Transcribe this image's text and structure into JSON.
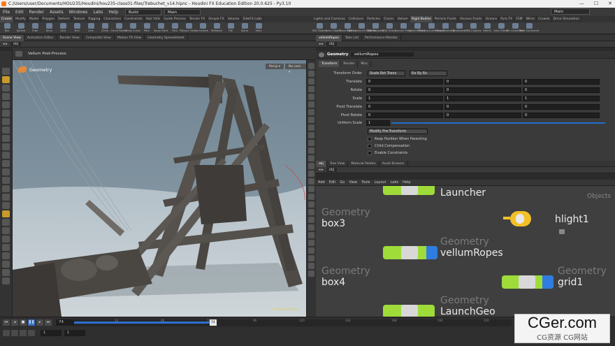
{
  "titlebar": {
    "text": "C:/Users/user/Documents/HOU235/Houdini/hou235-class01-files/Trebuchet_v14.hipnc - Houdini FX Education Edition 20.0.625 - Py3.10",
    "minimize": "—",
    "maximize": "☐",
    "close": "✕"
  },
  "menubar": {
    "items": [
      "File",
      "Edit",
      "Render",
      "Assets",
      "Windows",
      "Labs",
      "Help"
    ],
    "build_label": "Build",
    "main_label": "Main",
    "right_main_label": "Main"
  },
  "shelf_tabs_left": [
    "Create",
    "Modify",
    "Model",
    "Polygon",
    "Deform",
    "Texture",
    "Rigging",
    "Characters",
    "Constraints",
    "Hair Utils",
    "Guide Process",
    "Terrain FX",
    "Simple FX",
    "Volume",
    "SideFX Labs"
  ],
  "shelf_tabs_right": [
    "Lights and Cameras",
    "Collisions",
    "Particles",
    "Grains",
    "Vellum",
    "Rigid Bodies",
    "Particle Fluids",
    "Viscous Fluids",
    "Oceans",
    "Pyro FX",
    "FEM",
    "Wires",
    "Crowds",
    "Drive Simulation"
  ],
  "shelf_tools_left": [
    "Box",
    "Sphere",
    "Tube",
    "Torus",
    "Grid",
    "Null",
    "Line",
    "Circle",
    "Curve Bezier",
    "Draw Curve",
    "Path",
    "Spray Paint",
    "Font",
    "Platonic Solids",
    "L-System",
    "Metaball",
    "File",
    "Spiral",
    "Helix"
  ],
  "shelf_tools_right": [
    "RBD Objects",
    "Auto Object",
    "Glued Objects",
    "RBD Instanced Objects",
    "RBD Ragdolls",
    "RBD Grains",
    "Convex Proxy",
    "Sphere Proxy",
    "RBD Fractured Object",
    "Keep Breakable",
    "Breakable",
    "RBD Impacts",
    "Debris",
    "Auto Freeze",
    "Pin Constraint",
    "Twist Constraint"
  ],
  "left_pane": {
    "tabs": [
      "Scene View",
      "Animation Editor",
      "Render View",
      "Composite View",
      "Motion FX View",
      "Geometry Spreadsheet"
    ],
    "path": "obj",
    "viewport_title": "Vellum Post-Process",
    "context_label": "Geometry",
    "persp_label": "Persp ▾",
    "cam_label": "No cam ▾",
    "edu_label": "Education Edition"
  },
  "params_pane": {
    "tabs": [
      "vellumRopes",
      "Take List",
      "Performance Monitor"
    ],
    "path": "obj",
    "header_type": "Geometry",
    "header_name": "vellumRopes",
    "subtabs": [
      "Transform",
      "Render",
      "Misc"
    ],
    "transform_order_label": "Transform Order",
    "transform_order_value": "Scale Rot Trans",
    "rot_order_value": "Rx Ry Rz",
    "rows": [
      {
        "label": "Translate",
        "v": [
          "0",
          "0",
          "0"
        ]
      },
      {
        "label": "Rotate",
        "v": [
          "0",
          "0",
          "0"
        ]
      },
      {
        "label": "Scale",
        "v": [
          "1",
          "1",
          "1"
        ]
      },
      {
        "label": "Pivot Translate",
        "v": [
          "0",
          "0",
          "0"
        ]
      },
      {
        "label": "Pivot Rotate",
        "v": [
          "0",
          "0",
          "0"
        ]
      }
    ],
    "uniform_scale_label": "Uniform Scale",
    "uniform_scale_value": "1",
    "modify_pre_transform": "Modify Pre-Transform",
    "checks": [
      "Keep Position When Parenting",
      "Child Compensation",
      "Enable Constraints"
    ]
  },
  "network_pane": {
    "tabs": [
      "obj",
      "Tree View",
      "Material Palette",
      "Asset Browser"
    ],
    "path": "obj",
    "menu": [
      "Add",
      "Edit",
      "Go",
      "View",
      "Tools",
      "Layout",
      "Labs",
      "Help"
    ],
    "context": "Objects",
    "nodes": [
      {
        "type": "",
        "name": "Launcher"
      },
      {
        "type": "Geometry",
        "name": "box3"
      },
      {
        "type": "",
        "name": "hlight1"
      },
      {
        "type": "Geometry",
        "name": "vellumRopes"
      },
      {
        "type": "Geometry",
        "name": "box4"
      },
      {
        "type": "Geometry",
        "name": "grid1"
      },
      {
        "type": "Geometry",
        "name": "LaunchGeo"
      }
    ]
  },
  "timeline": {
    "frame": "74",
    "frame_marker": "74",
    "ticks": [
      "24",
      "48",
      "74",
      "96",
      "120",
      "144",
      "168",
      "192",
      "216",
      "240"
    ],
    "start_a": "1",
    "start_b": "1"
  },
  "watermark": {
    "title": "CGer.com",
    "subtitle": "CG资源 CG网站"
  },
  "colors": {
    "node_green": "#9fdc3a",
    "node_blue": "#2f7de0",
    "light_yellow": "#f2c02a",
    "timeline_blue": "#2f6fd0"
  }
}
